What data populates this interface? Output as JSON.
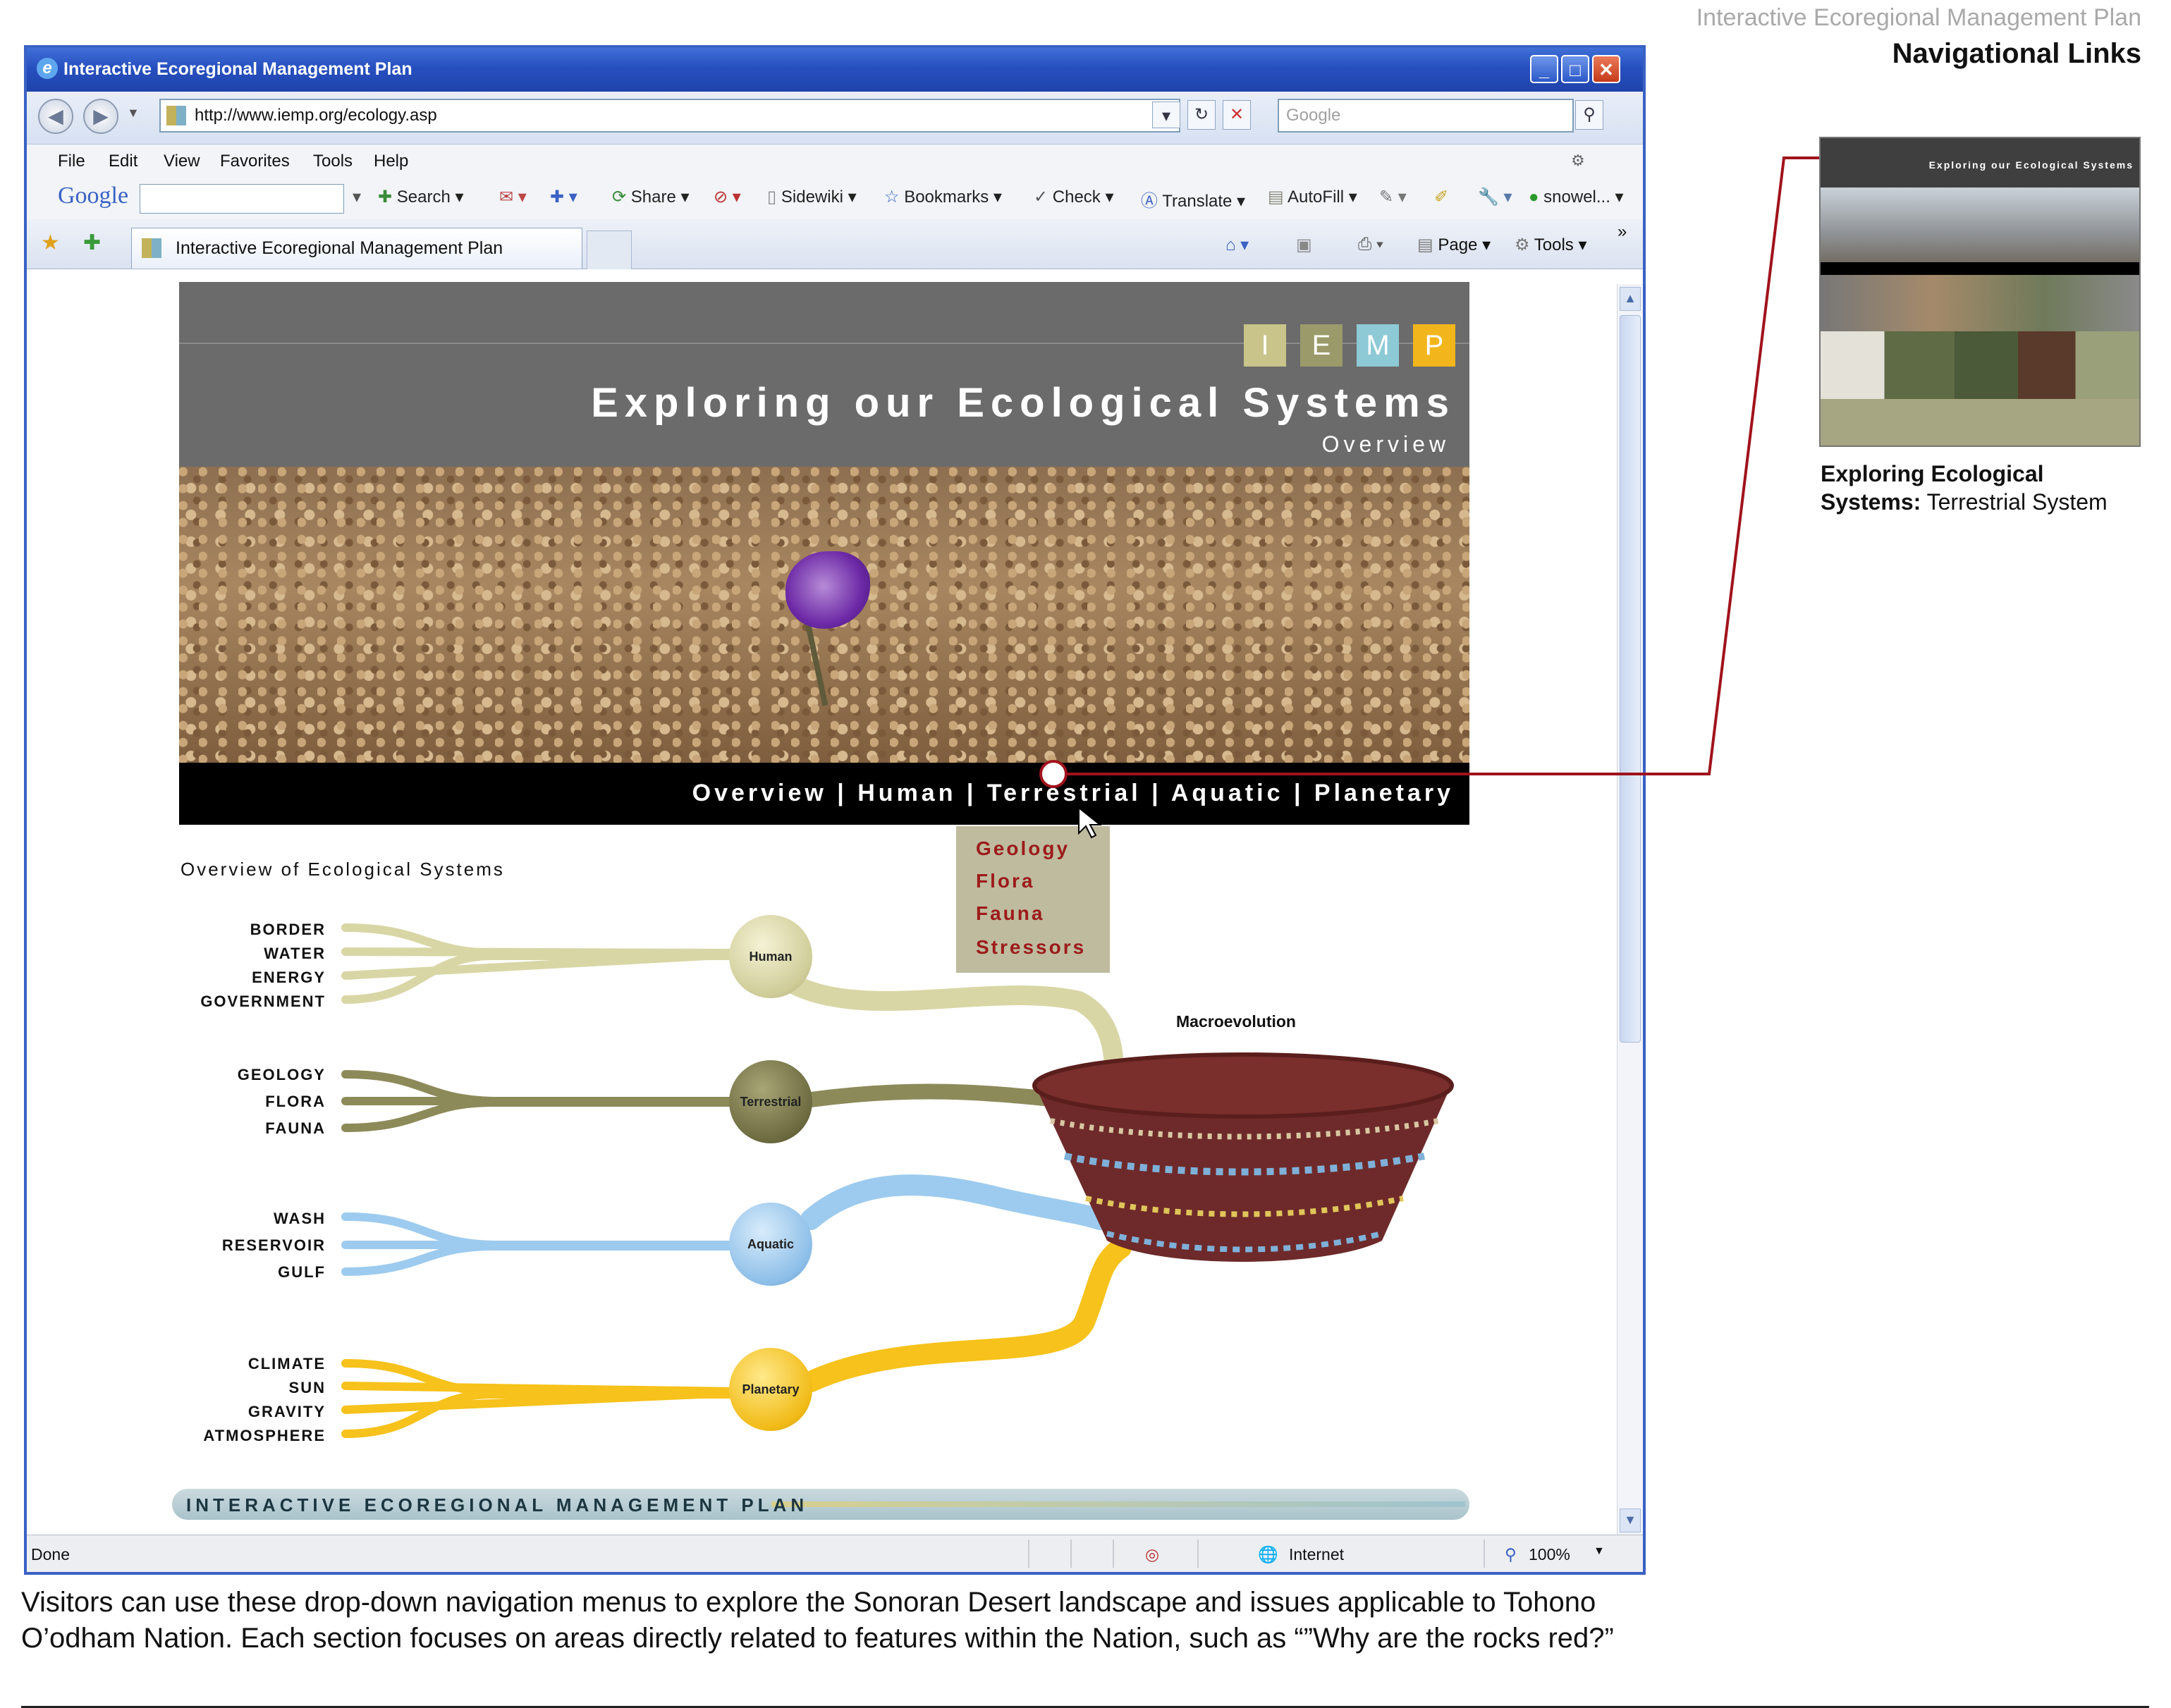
{
  "doc_header": {
    "subtitle": "Interactive Ecoregional Management Plan",
    "title": "Navigational Links"
  },
  "browser": {
    "window_title": "Interactive Ecoregional Management Plan",
    "address": "http://www.iemp.org/ecology.asp",
    "search_placeholder": "Google",
    "menu": [
      "File",
      "Edit",
      "View",
      "Favorites",
      "Tools",
      "Help"
    ],
    "google_toolbar": {
      "logo": "Google",
      "items": [
        "Search",
        "Share",
        "Sidewiki",
        "Bookmarks",
        "Check",
        "Translate",
        "AutoFill",
        "snowel..."
      ]
    },
    "tab_title": "Interactive Ecoregional Management Plan",
    "command_items": [
      "Page",
      "Tools"
    ],
    "status": {
      "left": "Done",
      "zone": "Internet",
      "zoom": "100%"
    }
  },
  "page": {
    "logo_letters": [
      "I",
      "E",
      "M",
      "P"
    ],
    "logo_colors": [
      "#c8c48a",
      "#9b9a6a",
      "#8ec9d6",
      "#f2b61c"
    ],
    "heading": "Exploring our Ecological Systems",
    "subheading": "Overview",
    "nav_links": "Overview | Human | Terrestrial | Aquatic | Planetary",
    "dropdown": [
      "Geology",
      "Flora",
      "Fauna",
      "Stressors"
    ],
    "overview_title": "Overview of Ecological Systems",
    "groups": [
      {
        "node": "Human",
        "labels": [
          "BORDER",
          "WATER",
          "ENERGY",
          "GOVERNMENT"
        ],
        "color": "#d9d6a6"
      },
      {
        "node": "Terrestrial",
        "labels": [
          "GEOLOGY",
          "FLORA",
          "FAUNA"
        ],
        "color": "#8d8a5a"
      },
      {
        "node": "Aquatic",
        "labels": [
          "WASH",
          "RESERVOIR",
          "GULF"
        ],
        "color": "#9dcbef"
      },
      {
        "node": "Planetary",
        "labels": [
          "CLIMATE",
          "SUN",
          "GRAVITY",
          "ATMOSPHERE"
        ],
        "color": "#f6c21b"
      }
    ],
    "macro_label": "Macroevolution",
    "footer_text": "INTERACTIVE ECOREGIONAL MANAGEMENT PLAN"
  },
  "callout": {
    "caption_bold": "Exploring Ecological Systems:",
    "caption_normal": "Terrestrial System",
    "thumb_title": "Exploring our Ecological Systems"
  },
  "caption": "Visitors can use these drop-down navigation menus to explore the Sonoran Desert landscape and issues applicable to Tohono O’odham Nation. Each section focuses on areas directly related to features within the Nation, such as “”Why are the rocks red?”"
}
